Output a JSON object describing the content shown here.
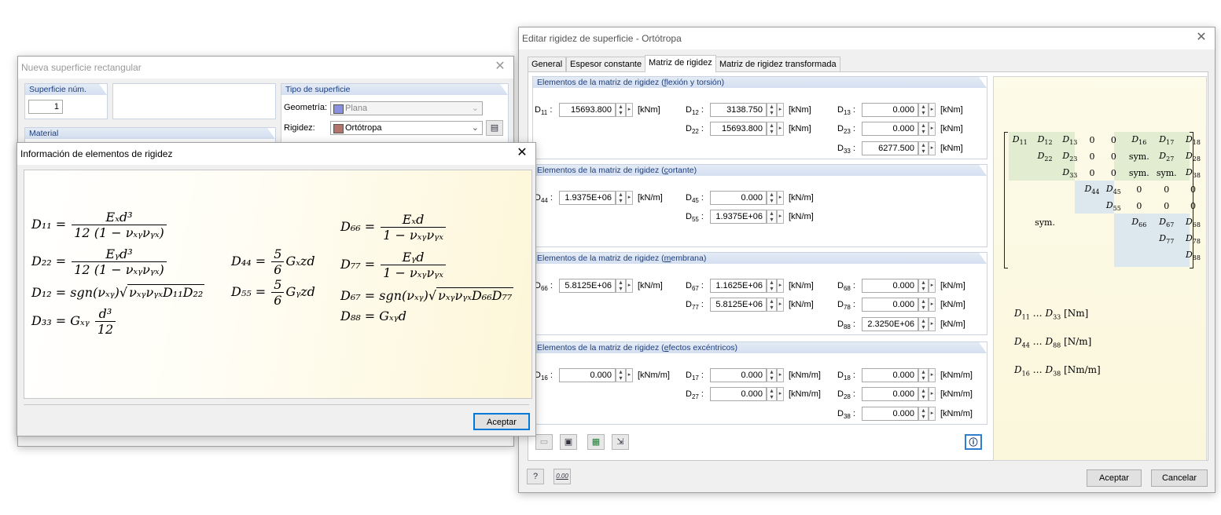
{
  "bg_window": {
    "title": "Nueva superficie rectangular",
    "surface_no_label": "Superficie núm.",
    "surface_no_value": "1",
    "surface_type_label": "Tipo de superficie",
    "material_label": "Material",
    "geometry_label": "Geometría:",
    "geometry_value": "Plana",
    "stiffness_label": "Rigidez:",
    "stiffness_value": "Ortótropa"
  },
  "info_dialog": {
    "title": "Información de elementos de rigidez",
    "ok_label": "Aceptar",
    "formulas": {
      "d11_lhs": "D₁₁ =",
      "d11_num": "Eₓd³",
      "d11_den": "12 (1 − νₓᵧνᵧₓ)",
      "d22_lhs": "D₂₂ =",
      "d22_num": "Eᵧd³",
      "d22_den": "12 (1 − νₓᵧνᵧₓ)",
      "d12_lhs": "D₁₂ = sgn(νₓᵧ)",
      "d12_rad": "νₓᵧνᵧₓD₁₁D₂₂",
      "d33_lhs": "D₃₃ = Gₓᵧ",
      "d33_num": "d³",
      "d33_den": "12",
      "d44_lhs": "D₄₄ =",
      "d44_num": "5",
      "d44_den": "6",
      "d44_rhs": "Gₓzd",
      "d55_lhs": "D₅₅ =",
      "d55_num": "5",
      "d55_den": "6",
      "d55_rhs": "Gᵧzd",
      "d66_lhs": "D₆₆ =",
      "d66_num": "Eₓd",
      "d66_den": "1 − νₓᵧνᵧₓ",
      "d77_lhs": "D₇₇ =",
      "d77_num": "Eᵧd",
      "d77_den": "1 − νₓᵧνᵧₓ",
      "d67_lhs": "D₆₇ = sgn(νₓᵧ)",
      "d67_rad": "νₓᵧνᵧₓD₆₆D₇₇",
      "d88": "D₈₈ = Gₓᵧd"
    }
  },
  "main_dialog": {
    "title": "Editar rigidez de superficie - Ortótropa",
    "tabs": [
      "General",
      "Espesor constante",
      "Matriz de rigidez",
      "Matriz de rigidez transformada"
    ],
    "ok_label": "Aceptar",
    "cancel_label": "Cancelar",
    "groups": {
      "bending": {
        "pre": "Elementos de la matriz de rigidez (",
        "key": "f",
        "post": "lexión y torsión)"
      },
      "shear": {
        "pre": "Elementos de la matriz de rigidez (",
        "key": "c",
        "post": "ortante)"
      },
      "membrane": {
        "pre": "Elementos de la matriz de rigidez (",
        "key": "m",
        "post": "embrana)"
      },
      "eccentric": {
        "pre": "Elementos de la matriz de rigidez (",
        "key": "e",
        "post": "fectos excéntricos)"
      }
    },
    "fields": {
      "d11": {
        "label": "D11 :",
        "value": "15693.800",
        "unit": "[kNm]"
      },
      "d12": {
        "label": "D12 :",
        "value": "3138.750",
        "unit": "[kNm]"
      },
      "d13": {
        "label": "D13 :",
        "value": "0.000",
        "unit": "[kNm]"
      },
      "d22": {
        "label": "D22 :",
        "value": "15693.800",
        "unit": "[kNm]"
      },
      "d23": {
        "label": "D23 :",
        "value": "0.000",
        "unit": "[kNm]"
      },
      "d33": {
        "label": "D33 :",
        "value": "6277.500",
        "unit": "[kNm]"
      },
      "d44": {
        "label": "D44 :",
        "value": "1.9375E+06",
        "unit": "[kN/m]"
      },
      "d45": {
        "label": "D45 :",
        "value": "0.000",
        "unit": "[kN/m]"
      },
      "d55": {
        "label": "D55 :",
        "value": "1.9375E+06",
        "unit": "[kN/m]"
      },
      "d66": {
        "label": "D66 :",
        "value": "5.8125E+06",
        "unit": "[kN/m]"
      },
      "d67": {
        "label": "D67 :",
        "value": "1.1625E+06",
        "unit": "[kN/m]"
      },
      "d68": {
        "label": "D68 :",
        "value": "0.000",
        "unit": "[kN/m]"
      },
      "d77": {
        "label": "D77 :",
        "value": "5.8125E+06",
        "unit": "[kN/m]"
      },
      "d78": {
        "label": "D78 :",
        "value": "0.000",
        "unit": "[kN/m]"
      },
      "d88": {
        "label": "D88 :",
        "value": "2.3250E+06",
        "unit": "[kN/m]"
      },
      "d16": {
        "label": "D16 :",
        "value": "0.000",
        "unit": "[kNm/m]"
      },
      "d17": {
        "label": "D17 :",
        "value": "0.000",
        "unit": "[kNm/m]"
      },
      "d18": {
        "label": "D18 :",
        "value": "0.000",
        "unit": "[kNm/m]"
      },
      "d27": {
        "label": "D27 :",
        "value": "0.000",
        "unit": "[kNm/m]"
      },
      "d28": {
        "label": "D28 :",
        "value": "0.000",
        "unit": "[kNm/m]"
      },
      "d38": {
        "label": "D38 :",
        "value": "0.000",
        "unit": "[kNm/m]"
      }
    },
    "matrix_rows": [
      [
        "D11",
        "D12",
        "D13",
        "0",
        "0",
        "D16",
        "D17",
        "D18"
      ],
      [
        "",
        "D22",
        "D23",
        "0",
        "0",
        "sym.",
        "D27",
        "D28"
      ],
      [
        "",
        "",
        "D33",
        "0",
        "0",
        "sym.",
        "sym.",
        "D38"
      ],
      [
        "",
        "",
        "",
        "D44",
        "D45",
        "0",
        "0",
        "0"
      ],
      [
        "",
        "",
        "",
        "",
        "D55",
        "0",
        "0",
        "0"
      ],
      [
        "",
        "sym.",
        "",
        "",
        "",
        "D66",
        "D67",
        "D68"
      ],
      [
        "",
        "",
        "",
        "",
        "",
        "",
        "D77",
        "D78"
      ],
      [
        "",
        "",
        "",
        "",
        "",
        "",
        "",
        "D88"
      ]
    ],
    "legend": [
      {
        "range": "D11 … D33",
        "unit": "[Nm]"
      },
      {
        "range": "D44 … D88",
        "unit": "[N/m]"
      },
      {
        "range": "D16 … D38",
        "unit": "[Nm/m]"
      }
    ],
    "calc_icon_text": "0.00"
  }
}
